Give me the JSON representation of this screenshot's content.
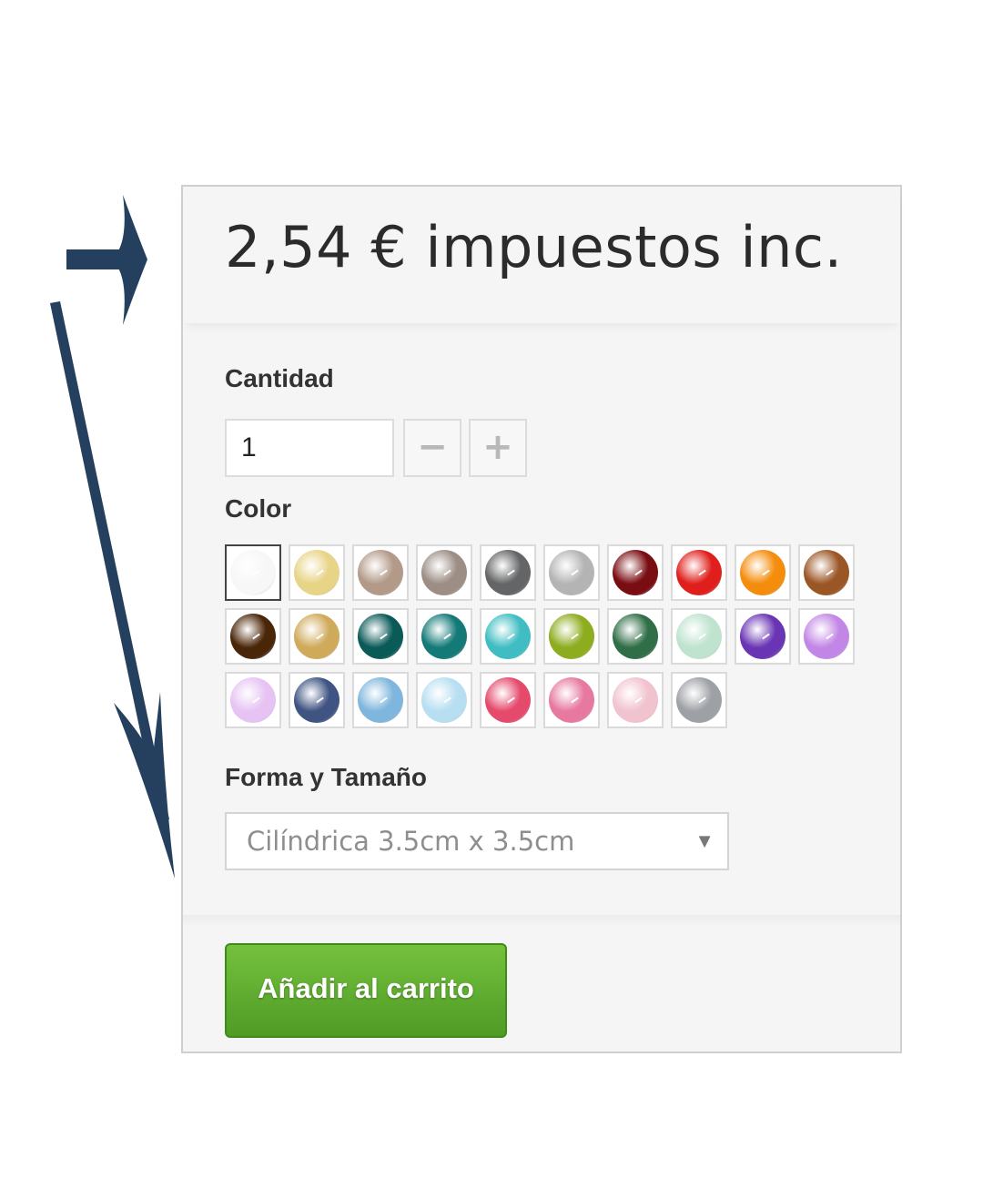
{
  "price": {
    "text": "2,54 € impuestos inc."
  },
  "quantity": {
    "label": "Cantidad",
    "value": "1",
    "minus_symbol": "−",
    "plus_symbol": "+"
  },
  "color": {
    "label": "Color",
    "selected_index": 0,
    "swatches": [
      "#f7f7f7",
      "#e8d486",
      "#b39a88",
      "#9c8e84",
      "#646566",
      "#b4b4b4",
      "#7a0d12",
      "#e01f1c",
      "#f48c0c",
      "#9b5625",
      "#4a2608",
      "#cfaa5a",
      "#0a5a58",
      "#137a78",
      "#3fbdc2",
      "#8dac1e",
      "#2f6e46",
      "#bfe3cf",
      "#6a35b4",
      "#c287e6",
      "#e6c3f3",
      "#3f5482",
      "#7fb6dd",
      "#b7dff1",
      "#e54a6c",
      "#e778a0",
      "#f1c3cf",
      "#9da0a4"
    ]
  },
  "shape": {
    "label": "Forma y Tamaño",
    "selected": "Cilíndrica 3.5cm x 3.5cm"
  },
  "cart": {
    "button_label": "Añadir al carrito"
  },
  "annotation_color": "#24405e"
}
